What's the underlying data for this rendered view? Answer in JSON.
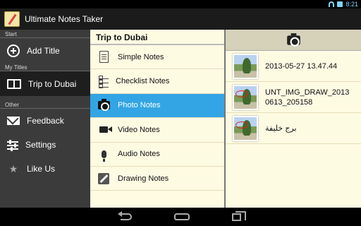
{
  "status_bar": {
    "time": "8:21"
  },
  "action_bar": {
    "title": "Ultimate Notes Taker"
  },
  "drawer": {
    "sections": {
      "start": "Start",
      "my_titles": "My Titles",
      "other": "Other"
    },
    "add_title": "Add Title",
    "titles": [
      {
        "label": "Trip to Dubai",
        "selected": true
      }
    ],
    "other_items": [
      {
        "label": "Feedback",
        "icon": "mail-icon"
      },
      {
        "label": "Settings",
        "icon": "sliders-icon"
      },
      {
        "label": "Like Us",
        "icon": "star-icon"
      }
    ]
  },
  "note_types": {
    "header": "Trip to Dubai",
    "items": [
      {
        "label": "Simple Notes",
        "icon": "document-icon"
      },
      {
        "label": "Checklist Notes",
        "icon": "checklist-icon"
      },
      {
        "label": "Photo Notes",
        "icon": "camera-icon",
        "selected": true
      },
      {
        "label": "Video Notes",
        "icon": "video-camera-icon"
      },
      {
        "label": "Audio Notes",
        "icon": "microphone-icon"
      },
      {
        "label": "Drawing Notes",
        "icon": "pencil-icon"
      }
    ]
  },
  "photos": {
    "toolbar_icon": "camera-icon",
    "items": [
      {
        "name": "2013-05-27 13.47.44"
      },
      {
        "name": "UNT_IMG_DRAW_2013\n0613_205158"
      },
      {
        "name": "برج خليفة"
      }
    ]
  },
  "colors": {
    "selected_blue": "#33a5e5",
    "panel_background": "#fefbe3",
    "drawer_background": "#3b3b3b"
  }
}
